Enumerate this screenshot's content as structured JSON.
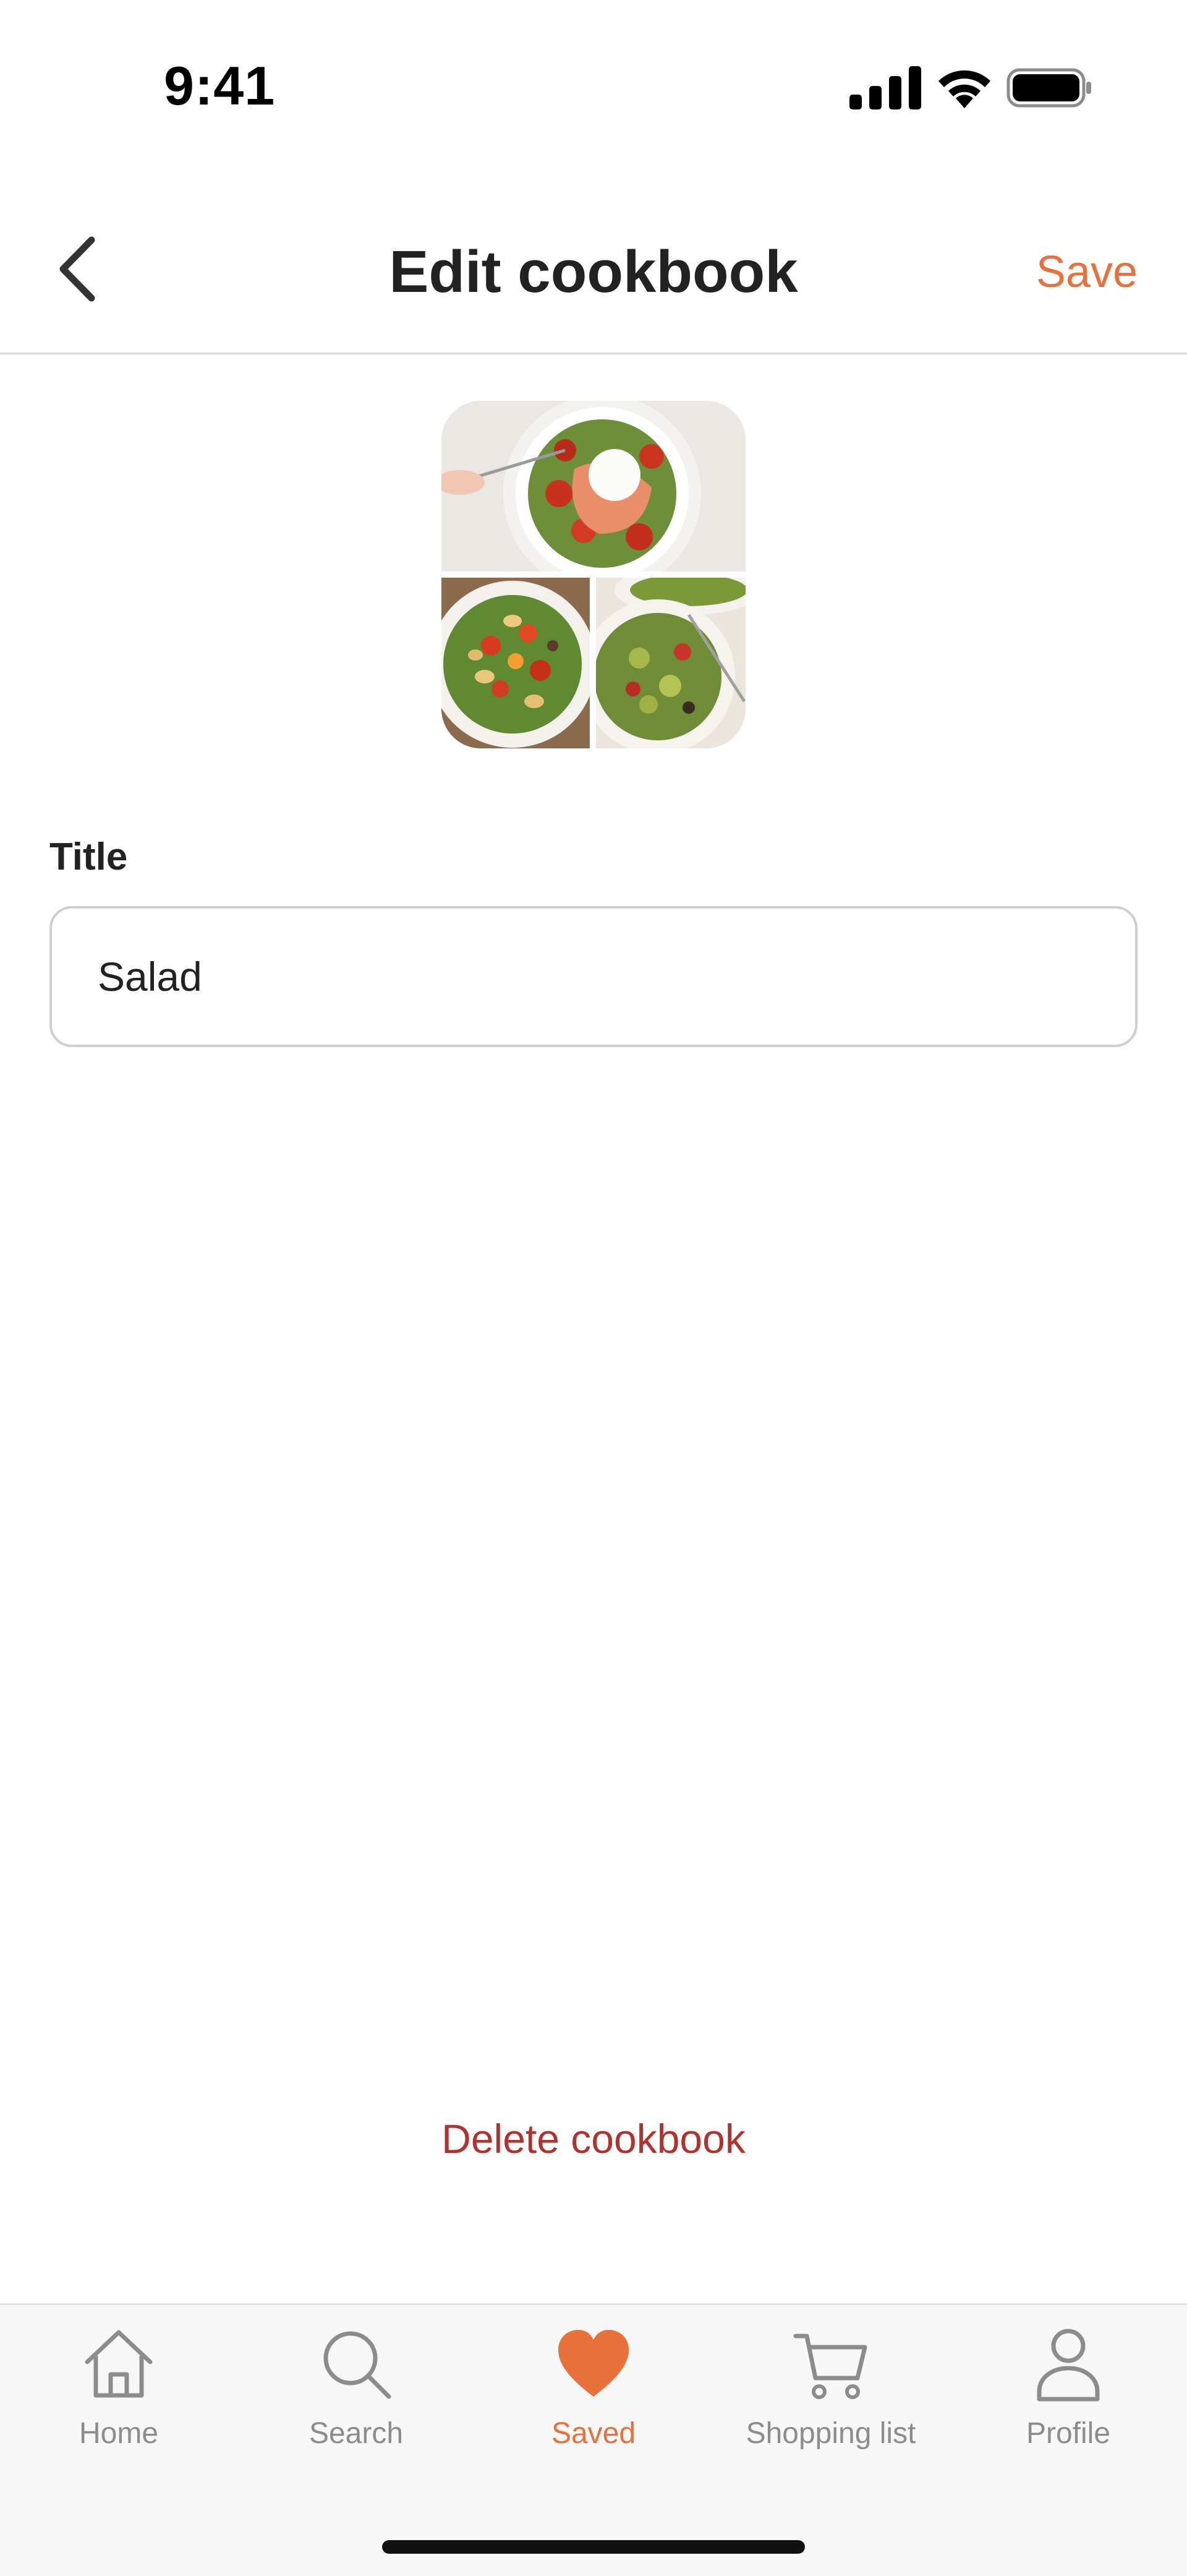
{
  "status_bar": {
    "time": "9:41",
    "icons": [
      "cellular-signal-icon",
      "wifi-icon",
      "battery-icon"
    ]
  },
  "header": {
    "back_icon": "chevron-left-icon",
    "title": "Edit cookbook",
    "save_label": "Save"
  },
  "cover": {
    "images": [
      "salmon-salad-bowl",
      "tortellini-salad-bowl",
      "green-salad-bowl"
    ]
  },
  "form": {
    "title_label": "Title",
    "title_value": "Salad"
  },
  "delete_label": "Delete cookbook",
  "tab_bar": {
    "tabs": [
      {
        "label": "Home",
        "icon": "home-icon",
        "active": false
      },
      {
        "label": "Search",
        "icon": "search-icon",
        "active": false
      },
      {
        "label": "Saved",
        "icon": "heart-icon",
        "active": true
      },
      {
        "label": "Shopping list",
        "icon": "cart-icon",
        "active": false
      },
      {
        "label": "Profile",
        "icon": "person-icon",
        "active": false
      }
    ]
  },
  "colors": {
    "accent": "#e8703a",
    "danger": "#b0332d",
    "inactive": "#8c8c8c",
    "text": "#222222"
  }
}
